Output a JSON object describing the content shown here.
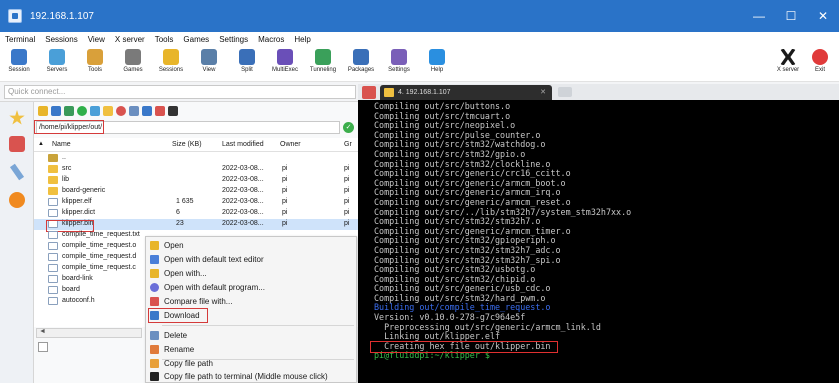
{
  "window": {
    "title": "192.168.1.107",
    "controls": [
      "—",
      "☐",
      "✕"
    ]
  },
  "menu": [
    "Terminal",
    "Sessions",
    "View",
    "X server",
    "Tools",
    "Games",
    "Settings",
    "Macros",
    "Help"
  ],
  "toolbar": {
    "items": [
      {
        "label": "Session",
        "icon": "session-icon",
        "color": "#3a78c9"
      },
      {
        "label": "Servers",
        "icon": "servers-icon",
        "color": "#4a9fd8"
      },
      {
        "label": "Tools",
        "icon": "tools-icon",
        "color": "#d9a03a"
      },
      {
        "label": "Games",
        "icon": "games-icon",
        "color": "#7a7a7a"
      },
      {
        "label": "Sessions",
        "icon": "star-icon",
        "color": "#e8b52a"
      },
      {
        "label": "View",
        "icon": "view-icon",
        "color": "#5a7fa8"
      },
      {
        "label": "Split",
        "icon": "split-icon",
        "color": "#3a6fb8"
      },
      {
        "label": "MultiExec",
        "icon": "multiexec-icon",
        "color": "#6a4fb8"
      },
      {
        "label": "Tunneling",
        "icon": "tunneling-icon",
        "color": "#3aa05a"
      },
      {
        "label": "Packages",
        "icon": "packages-icon",
        "color": "#3a6fb8"
      },
      {
        "label": "Settings",
        "icon": "settings-icon",
        "color": "#7a5fb8"
      },
      {
        "label": "Help",
        "icon": "help-icon",
        "color": "#2a8fe0"
      }
    ],
    "xserver_label": "X server",
    "exit_label": "Exit"
  },
  "quick_connect": {
    "placeholder": "Quick connect..."
  },
  "sftp": {
    "path": "/home/pi/klipper/out/",
    "columns": [
      "Name",
      "Size (KB)",
      "Last modified",
      "Owner",
      "Gr"
    ],
    "files": [
      {
        "name": "..",
        "size": "",
        "modified": "",
        "owner": "",
        "group": "",
        "kind": "up"
      },
      {
        "name": "src",
        "size": "",
        "modified": "2022-03-08...",
        "owner": "pi",
        "group": "pi",
        "kind": "folder"
      },
      {
        "name": "lib",
        "size": "",
        "modified": "2022-03-08...",
        "owner": "pi",
        "group": "pi",
        "kind": "folder"
      },
      {
        "name": "board-generic",
        "size": "",
        "modified": "2022-03-08...",
        "owner": "pi",
        "group": "pi",
        "kind": "folder"
      },
      {
        "name": "klipper.elf",
        "size": "1 635",
        "modified": "2022-03-08...",
        "owner": "pi",
        "group": "pi",
        "kind": "file"
      },
      {
        "name": "klipper.dict",
        "size": "6",
        "modified": "2022-03-08...",
        "owner": "pi",
        "group": "pi",
        "kind": "file"
      },
      {
        "name": "klipper.bin",
        "size": "23",
        "modified": "2022-03-08...",
        "owner": "pi",
        "group": "pi",
        "kind": "file"
      },
      {
        "name": "compile_time_request.txt",
        "size": "",
        "modified": "",
        "owner": "",
        "group": "",
        "kind": "file"
      },
      {
        "name": "compile_time_request.o",
        "size": "",
        "modified": "",
        "owner": "",
        "group": "",
        "kind": "file"
      },
      {
        "name": "compile_time_request.d",
        "size": "",
        "modified": "",
        "owner": "",
        "group": "",
        "kind": "file"
      },
      {
        "name": "compile_time_request.c",
        "size": "",
        "modified": "",
        "owner": "",
        "group": "",
        "kind": "file"
      },
      {
        "name": "board-link",
        "size": "",
        "modified": "",
        "owner": "",
        "group": "",
        "kind": "file"
      },
      {
        "name": "board",
        "size": "",
        "modified": "",
        "owner": "",
        "group": "",
        "kind": "file"
      },
      {
        "name": "autoconf.h",
        "size": "",
        "modified": "",
        "owner": "",
        "group": "",
        "kind": "file"
      }
    ]
  },
  "context_menu": {
    "open": "Open",
    "open_default_editor": "Open with default text editor",
    "open_with": "Open with...",
    "open_default_program": "Open with default program...",
    "compare": "Compare file with...",
    "download": "Download",
    "delete": "Delete",
    "rename": "Rename",
    "copy_path": "Copy file path",
    "copy_path_terminal": "Copy file path to terminal (Middle mouse click)"
  },
  "terminal": {
    "tab_label": "4. 192.168.1.107",
    "lines": [
      {
        "text": "Compiling out/src/buttons.o",
        "style": ""
      },
      {
        "text": "Compiling out/src/tmcuart.o",
        "style": ""
      },
      {
        "text": "Compiling out/src/neopixel.o",
        "style": ""
      },
      {
        "text": "Compiling out/src/pulse_counter.o",
        "style": ""
      },
      {
        "text": "Compiling out/src/stm32/watchdog.o",
        "style": ""
      },
      {
        "text": "Compiling out/src/stm32/gpio.o",
        "style": ""
      },
      {
        "text": "Compiling out/src/stm32/clockline.o",
        "style": ""
      },
      {
        "text": "Compiling out/src/generic/crc16_ccitt.o",
        "style": ""
      },
      {
        "text": "Compiling out/src/generic/armcm_boot.o",
        "style": ""
      },
      {
        "text": "Compiling out/src/generic/armcm_irq.o",
        "style": ""
      },
      {
        "text": "Compiling out/src/generic/armcm_reset.o",
        "style": ""
      },
      {
        "text": "Compiling out/src/../lib/stm32h7/system_stm32h7xx.o",
        "style": ""
      },
      {
        "text": "Compiling out/src/stm32/stm32h7.o",
        "style": ""
      },
      {
        "text": "Compiling out/src/generic/armcm_timer.o",
        "style": ""
      },
      {
        "text": "Compiling out/src/stm32/gpioperiph.o",
        "style": ""
      },
      {
        "text": "Compiling out/src/stm32/stm32h7_adc.o",
        "style": ""
      },
      {
        "text": "Compiling out/src/stm32/stm32h7_spi.o",
        "style": ""
      },
      {
        "text": "Compiling out/src/stm32/usbotg.o",
        "style": ""
      },
      {
        "text": "Compiling out/src/stm32/chipid.o",
        "style": ""
      },
      {
        "text": "Compiling out/src/generic/usb_cdc.o",
        "style": ""
      },
      {
        "text": "Compiling out/src/stm32/hard_pwm.o",
        "style": ""
      },
      {
        "text": "Building out/compile_time_request.o",
        "style": "blue"
      },
      {
        "text": "Version: v0.10.0-278-g7c964e5f",
        "style": ""
      },
      {
        "text": "  Preprocessing out/src/generic/armcm_link.ld",
        "style": ""
      },
      {
        "text": "  Linking out/klipper.elf",
        "style": ""
      },
      {
        "text": "  Creating hex file out/klipper.bin",
        "style": ""
      },
      {
        "text": "pi@fluiddpi:~/klipper $ ",
        "style": "green"
      }
    ]
  },
  "colors": {
    "titlebar": "#2a73c8",
    "highlight": "#d43a3a",
    "terminal_bg": "#000000",
    "selection": "#cfe3fa"
  }
}
